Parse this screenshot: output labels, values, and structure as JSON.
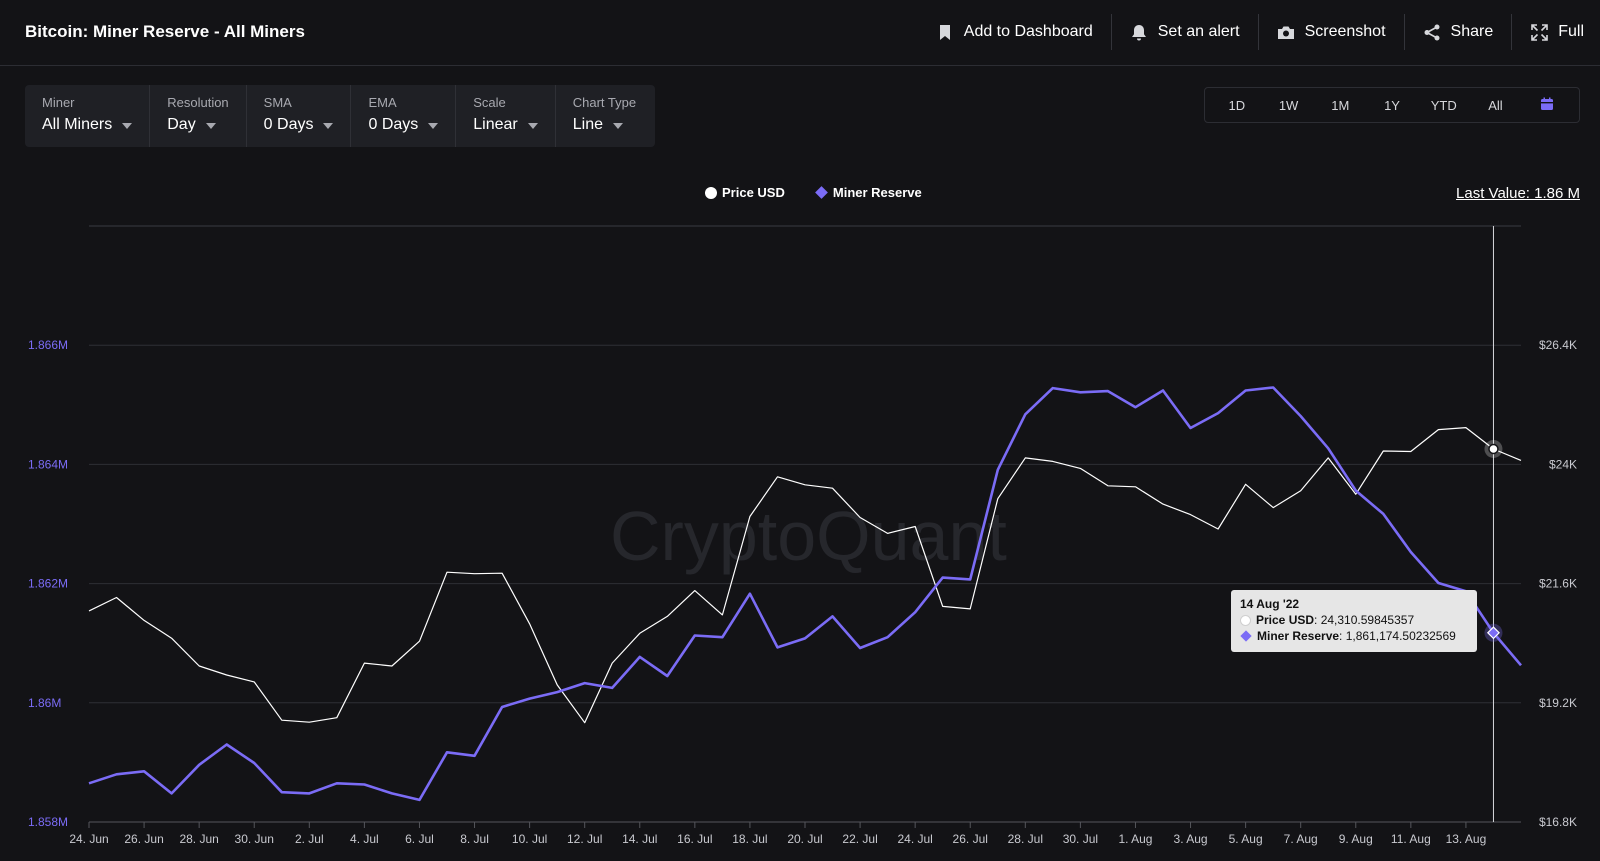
{
  "header": {
    "title": "Bitcoin: Miner Reserve - All Miners",
    "actions": {
      "add_dashboard": "Add to Dashboard",
      "set_alert": "Set an alert",
      "screenshot": "Screenshot",
      "share": "Share",
      "full": "Full"
    }
  },
  "filters": [
    {
      "label": "Miner",
      "value": "All Miners"
    },
    {
      "label": "Resolution",
      "value": "Day"
    },
    {
      "label": "SMA",
      "value": "0 Days"
    },
    {
      "label": "EMA",
      "value": "0 Days"
    },
    {
      "label": "Scale",
      "value": "Linear"
    },
    {
      "label": "Chart Type",
      "value": "Line"
    }
  ],
  "ranges": [
    "1D",
    "1W",
    "1M",
    "1Y",
    "YTD",
    "All"
  ],
  "last_value": "Last Value: 1.86 M",
  "watermark": "CryptoQuant",
  "tooltip": {
    "date": "14 Aug '22",
    "price_label": "Price USD",
    "price_value": ": 24,310.59845357",
    "reserve_label": "Miner Reserve",
    "reserve_value": ": 1,861,174.50232569"
  },
  "colors": {
    "background": "#131316",
    "reserve_line": "#7b6cf6",
    "price_line": "#ffffff"
  },
  "chart_data": {
    "type": "line",
    "legend": [
      "Price USD",
      "Miner Reserve"
    ],
    "legend_position": "top-center",
    "grid": true,
    "x_tick_labels": [
      "24. Jun",
      "26. Jun",
      "28. Jun",
      "30. Jun",
      "2. Jul",
      "4. Jul",
      "6. Jul",
      "8. Jul",
      "10. Jul",
      "12. Jul",
      "14. Jul",
      "16. Jul",
      "18. Jul",
      "20. Jul",
      "22. Jul",
      "24. Jul",
      "26. Jul",
      "28. Jul",
      "30. Jul",
      "1. Aug",
      "3. Aug",
      "5. Aug",
      "7. Aug",
      "9. Aug",
      "11. Aug",
      "13. Aug"
    ],
    "y_left": {
      "ticks": [
        "1.858M",
        "1.86M",
        "1.862M",
        "1.864M",
        "1.866M"
      ],
      "range": [
        1858000,
        1868000
      ]
    },
    "y_right": {
      "ticks": [
        "$16.8K",
        "$19.2K",
        "$21.6K",
        "$24K",
        "$26.4K"
      ],
      "range": [
        16800,
        28800
      ]
    },
    "series": [
      {
        "name": "Miner Reserve",
        "axis": "left",
        "values": [
          1858650,
          1858800,
          1858850,
          1858480,
          1858960,
          1859300,
          1858990,
          1858500,
          1858480,
          1858650,
          1858630,
          1858480,
          1858370,
          1859170,
          1859110,
          1859930,
          1860070,
          1860180,
          1860330,
          1860250,
          1860770,
          1860450,
          1861130,
          1861100,
          1861830,
          1860930,
          1861080,
          1861450,
          1860920,
          1861100,
          1861520,
          1862100,
          1862070,
          1863910,
          1864840,
          1865280,
          1865210,
          1865230,
          1864960,
          1865240,
          1864610,
          1864860,
          1865240,
          1865290,
          1864810,
          1864270,
          1863560,
          1863170,
          1862530,
          1862010,
          1861870,
          1861174.50232569,
          1860630
        ]
      },
      {
        "name": "Price USD",
        "axis": "right",
        "values": [
          21050,
          21320,
          20860,
          20500,
          19940,
          19760,
          19620,
          18850,
          18810,
          18900,
          20000,
          19940,
          20440,
          21830,
          21800,
          21810,
          20790,
          19560,
          18800,
          20000,
          20600,
          20940,
          21460,
          20970,
          22950,
          23750,
          23590,
          23520,
          22930,
          22610,
          22750,
          21140,
          21090,
          23310,
          24130,
          24060,
          23920,
          23570,
          23550,
          23200,
          22990,
          22700,
          23600,
          23130,
          23470,
          24130,
          23400,
          24270,
          24260,
          24700,
          24740,
          24310.59845357,
          24080
        ]
      }
    ]
  }
}
